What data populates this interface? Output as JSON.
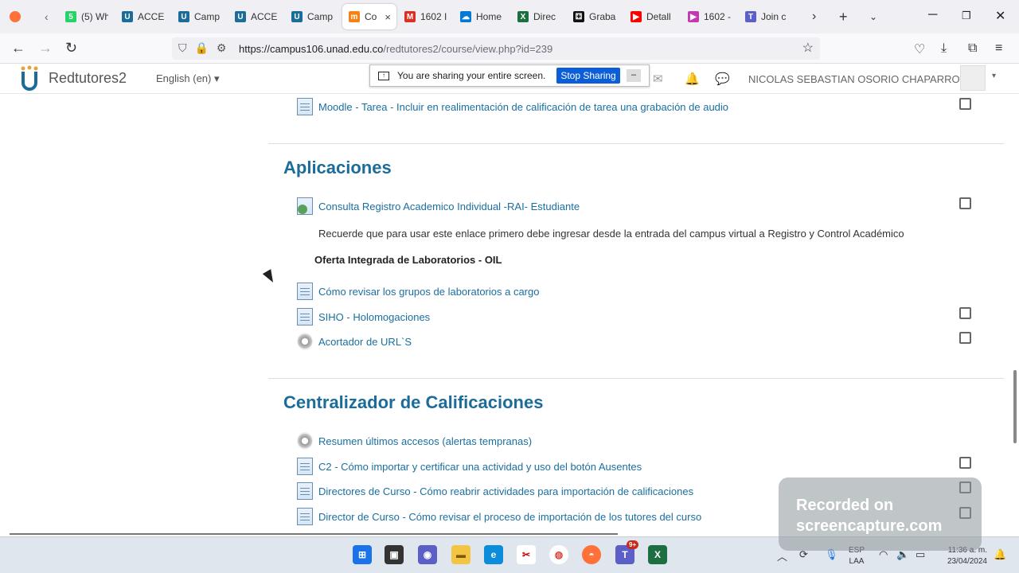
{
  "browser": {
    "tabs": [
      {
        "label": "(5) Wh",
        "icon": "whatsapp-icon",
        "color": "#25d366",
        "glyph": "5"
      },
      {
        "label": "ACCE",
        "icon": "unad-icon",
        "color": "#1c6c9a",
        "glyph": "U"
      },
      {
        "label": "Camp",
        "icon": "unad-icon",
        "color": "#1c6c9a",
        "glyph": "U"
      },
      {
        "label": "ACCE",
        "icon": "unad-icon",
        "color": "#1c6c9a",
        "glyph": "U"
      },
      {
        "label": "Camp",
        "icon": "unad-icon",
        "color": "#1c6c9a",
        "glyph": "U"
      },
      {
        "label": "Co",
        "icon": "moodle-icon",
        "color": "#f98012",
        "glyph": "m"
      },
      {
        "label": "1602 I",
        "icon": "gmail-icon",
        "color": "#d93025",
        "glyph": "M"
      },
      {
        "label": "Home",
        "icon": "onedrive-icon",
        "color": "#0078d4",
        "glyph": "☁"
      },
      {
        "label": "Direc",
        "icon": "excel-icon",
        "color": "#1d6f42",
        "glyph": "X"
      },
      {
        "label": "Graba",
        "icon": "dice-icon",
        "color": "#111111",
        "glyph": "⚃"
      },
      {
        "label": "Detall",
        "icon": "youtube-icon",
        "color": "#ff0000",
        "glyph": "▶"
      },
      {
        "label": "1602 -",
        "icon": "stream-icon",
        "color": "#c239b3",
        "glyph": "▶"
      },
      {
        "label": "Join c",
        "icon": "teams-icon",
        "color": "#5b5fc7",
        "glyph": "T"
      }
    ],
    "active_tab_close": "×",
    "url_host": "https://campus106.unad.edu.co",
    "url_path": "/redtutores2/course/view.php?id=239"
  },
  "header": {
    "site_name": "Redtutores2",
    "language": "English (en) ▾",
    "share_text": "You are sharing your entire screen.",
    "stop_sharing": "Stop Sharing",
    "minimize": "–",
    "username": "NICOLAS SEBASTIAN OSORIO CHAPARRO",
    "user_caret": "▾"
  },
  "content": {
    "top_item": "Moodle - Tarea - Incluir en realimentación de calificación de tarea una grabación de audio",
    "section1": {
      "title": "Aplicaciones",
      "item1": "Consulta Registro Academico Individual -RAI- Estudiante",
      "note": "Recuerde que para usar este enlace primero debe ingresar desde la entrada del campus virtual a Registro y Control Académico",
      "subhead": "Oferta Integrada de Laboratorios - OIL",
      "item2": "Cómo revisar los grupos de laboratorios a cargo",
      "item3": "SIHO - Holomogaciones",
      "item4": "Acortador de URL`S"
    },
    "section2": {
      "title": "Centralizador de Calificaciones",
      "item1": "Resumen últimos accesos (alertas tempranas)",
      "item2": "C2 - Cómo importar y certificar una actividad y uso del botón Ausentes",
      "item3": "Directores de Curso - Cómo reabrir actividades para importación de calificaciones",
      "item4": "Director de Curso - Cómo revisar el proceso de importación de los tutores del curso"
    }
  },
  "watermark": {
    "line1": "Recorded on",
    "line2": "screencapture.com"
  },
  "taskbar": {
    "badge": "9+",
    "lang_top": "ESP",
    "lang_bottom": "LAA",
    "time": "11:36 a. m.",
    "date": "23/04/2024"
  }
}
